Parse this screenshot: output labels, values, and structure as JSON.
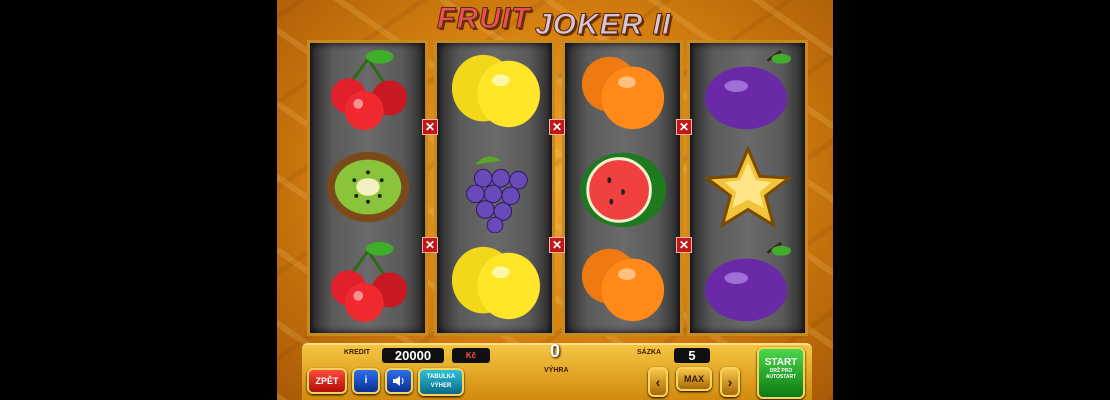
{
  "logo": {
    "line1": "FRUIT",
    "line2": "JOKER II"
  },
  "reels": [
    {
      "symbols": [
        "cherries-symbol",
        "kiwi-symbol",
        "cherries-symbol"
      ]
    },
    {
      "symbols": [
        "lemon-symbol",
        "grapes-symbol",
        "lemon-symbol"
      ]
    },
    {
      "symbols": [
        "orange-symbol",
        "watermelon-symbol",
        "orange-symbol"
      ]
    },
    {
      "symbols": [
        "plum-symbol",
        "star-symbol",
        "plum-symbol"
      ]
    }
  ],
  "panel": {
    "credit_label": "KREDIT",
    "credit_value": "20000",
    "currency": "Kč",
    "win_value": "0",
    "win_label": "VÝHRA",
    "bet_label": "SÁZKA",
    "bet_value": "5",
    "back_label": "ZPĚT",
    "info_label": "i",
    "sound_icon": "speaker-icon",
    "paytable_label_1": "TABULKA",
    "paytable_label_2": "VÝHER",
    "max_label": "MAX",
    "start_label": "START",
    "start_sub_1": "DRŽ PRO",
    "start_sub_2": "AUTOSTART"
  },
  "colors": {
    "accent": "#f5c542",
    "start": "#2fa82f",
    "back": "#d0180c",
    "info": "#1e50c8"
  }
}
